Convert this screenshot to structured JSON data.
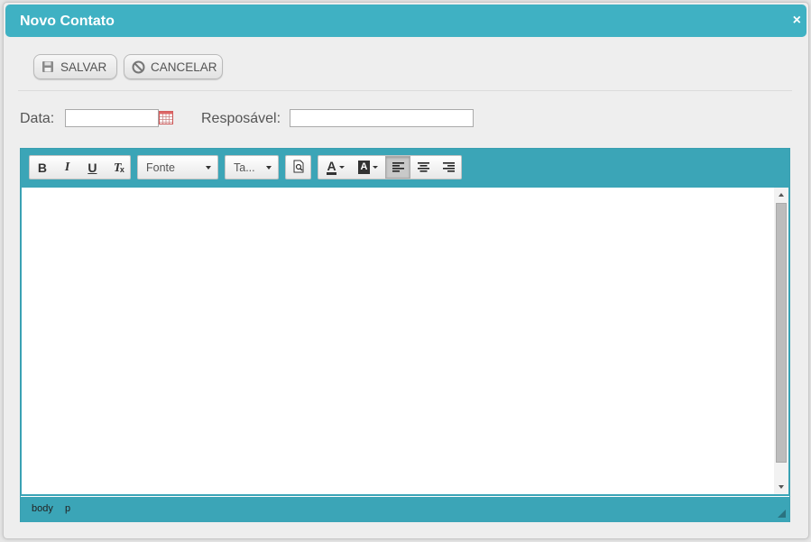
{
  "dialog": {
    "title": "Novo Contato",
    "close_symbol": "×"
  },
  "toolbar": {
    "save_label": "SALVAR",
    "save_icon": "floppy-disk-icon",
    "cancel_label": "CANCELAR",
    "cancel_icon": "cancel-circle-icon"
  },
  "form": {
    "date_label": "Data:",
    "date_value": "",
    "date_icon": "calendar-icon",
    "responsible_label": "Resposável:",
    "responsible_value": ""
  },
  "editor": {
    "bold_label": "B",
    "italic_label": "I",
    "underline_label": "U",
    "remove_format_label": "T",
    "remove_format_sub": "x",
    "font_combo_label": "Fonte",
    "size_combo_label": "Ta...",
    "preview_icon": "preview-icon",
    "text_color_label": "A",
    "bg_color_label": "A",
    "align_left_icon": "align-left-icon",
    "align_center_icon": "align-center-icon",
    "align_right_icon": "align-right-icon",
    "content_text": "",
    "path": [
      "body",
      "p"
    ]
  },
  "colors": {
    "accent": "#3fb1c3",
    "editor_bar": "#3ba5b7"
  }
}
